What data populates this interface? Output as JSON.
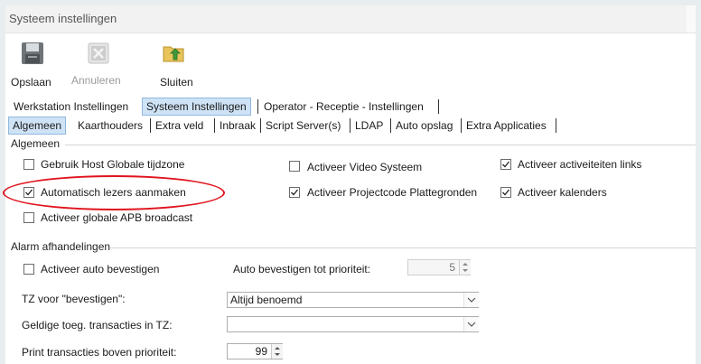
{
  "window": {
    "title": "Systeem instellingen"
  },
  "toolbar": {
    "save_label": "Opslaan",
    "cancel_label": "Annuleren",
    "close_label": "Sluiten",
    "icons": [
      "floppy-disk-icon",
      "cancel-x-icon",
      "folder-exit-icon"
    ]
  },
  "top_tabs": [
    "Werkstation Instellingen",
    "Systeem Instellingen",
    "Operator - Receptie - Instellingen"
  ],
  "sub_tabs": [
    "Algemeen",
    "Kaarthouders",
    "Extra veld",
    "Inbraak",
    "Script Server(s)",
    "LDAP",
    "Auto opslag",
    "Extra Applicaties"
  ],
  "algemeen": {
    "group_title": "Algemeen",
    "checkboxes": [
      {
        "label": "Gebruik Host Globale tijdzone",
        "checked": false
      },
      {
        "label": "Activeer Video Systeem",
        "checked": false
      },
      {
        "label": "Activeer activeiteiten links",
        "checked": true
      },
      {
        "label": "Automatisch lezers aanmaken",
        "checked": true
      },
      {
        "label": "Activeer Projectcode Plattegronden",
        "checked": true
      },
      {
        "label": "Activeer kalenders",
        "checked": true
      },
      {
        "label": "Activeer globale APB broadcast",
        "checked": false
      }
    ]
  },
  "alarm": {
    "group_title": "Alarm afhandelingen",
    "auto_confirm_label": "Activeer auto bevestigen",
    "auto_confirm_checked": false,
    "priority_label": "Auto bevestigen tot prioriteit:",
    "priority_value": "5",
    "tz_label": "TZ voor \"bevestigen\":",
    "tz_value": "Altijd benoemd",
    "valid_label": "Geldige toeg. transacties in TZ:",
    "valid_value": "",
    "print_label": "Print transacties boven prioriteit:",
    "print_value": "99"
  },
  "colors": {
    "accent": "#cfe3f6",
    "highlight": "#e0141e"
  }
}
